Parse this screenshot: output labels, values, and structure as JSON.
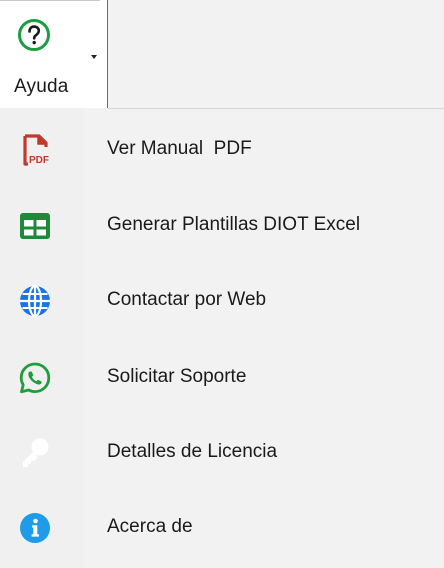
{
  "ribbon": {
    "help_button_label": "Ayuda",
    "help_icon": "question-circle-icon"
  },
  "menu": {
    "items": [
      {
        "label": "Ver Manual  PDF",
        "icon": "pdf-file-icon",
        "color": "#c0392b"
      },
      {
        "label": "Generar Plantillas DIOT Excel",
        "icon": "excel-grid-icon",
        "color": "#1d8a3a"
      },
      {
        "label": "Contactar por Web",
        "icon": "globe-icon",
        "color": "#1a73e8"
      },
      {
        "label": "Solicitar Soporte",
        "icon": "whatsapp-icon",
        "color": "#1e9e3a"
      },
      {
        "label": "Detalles de Licencia",
        "icon": "key-icon",
        "color": "#ffffff"
      },
      {
        "label": "Acerca de",
        "icon": "info-circle-icon",
        "color": "#1e9be9"
      }
    ]
  }
}
